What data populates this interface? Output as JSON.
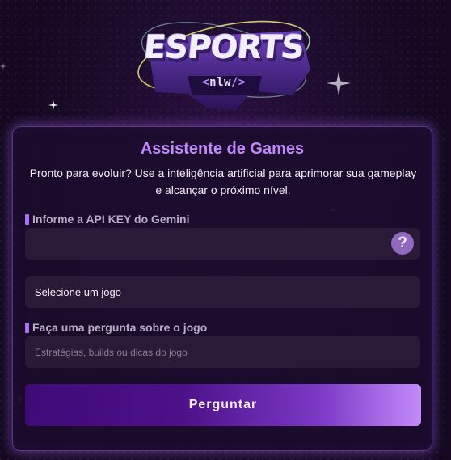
{
  "logo": {
    "word": "ESPORTS",
    "tag_open": "<",
    "tag_text": "nlw",
    "tag_close": "/>"
  },
  "card": {
    "title": "Assistente de Games",
    "subtitle": "Pronto para evoluir? Use a inteligência artificial para aprimorar sua gameplay e alcançar o próximo nível."
  },
  "api_key": {
    "label": "Informe a API KEY do Gemini",
    "value": "",
    "help_icon": "question-circle-icon",
    "help_glyph": "?"
  },
  "game_select": {
    "selected": "Selecione um jogo"
  },
  "question": {
    "label": "Faça uma pergunta sobre o jogo",
    "placeholder": "Estratégias, builds ou dicas do jogo"
  },
  "submit": {
    "label": "Perguntar"
  },
  "colors": {
    "accent": "#c189fb",
    "label_marker": "#b06dfa",
    "button_start": "#3f0a78",
    "button_end": "#c38bfa"
  }
}
